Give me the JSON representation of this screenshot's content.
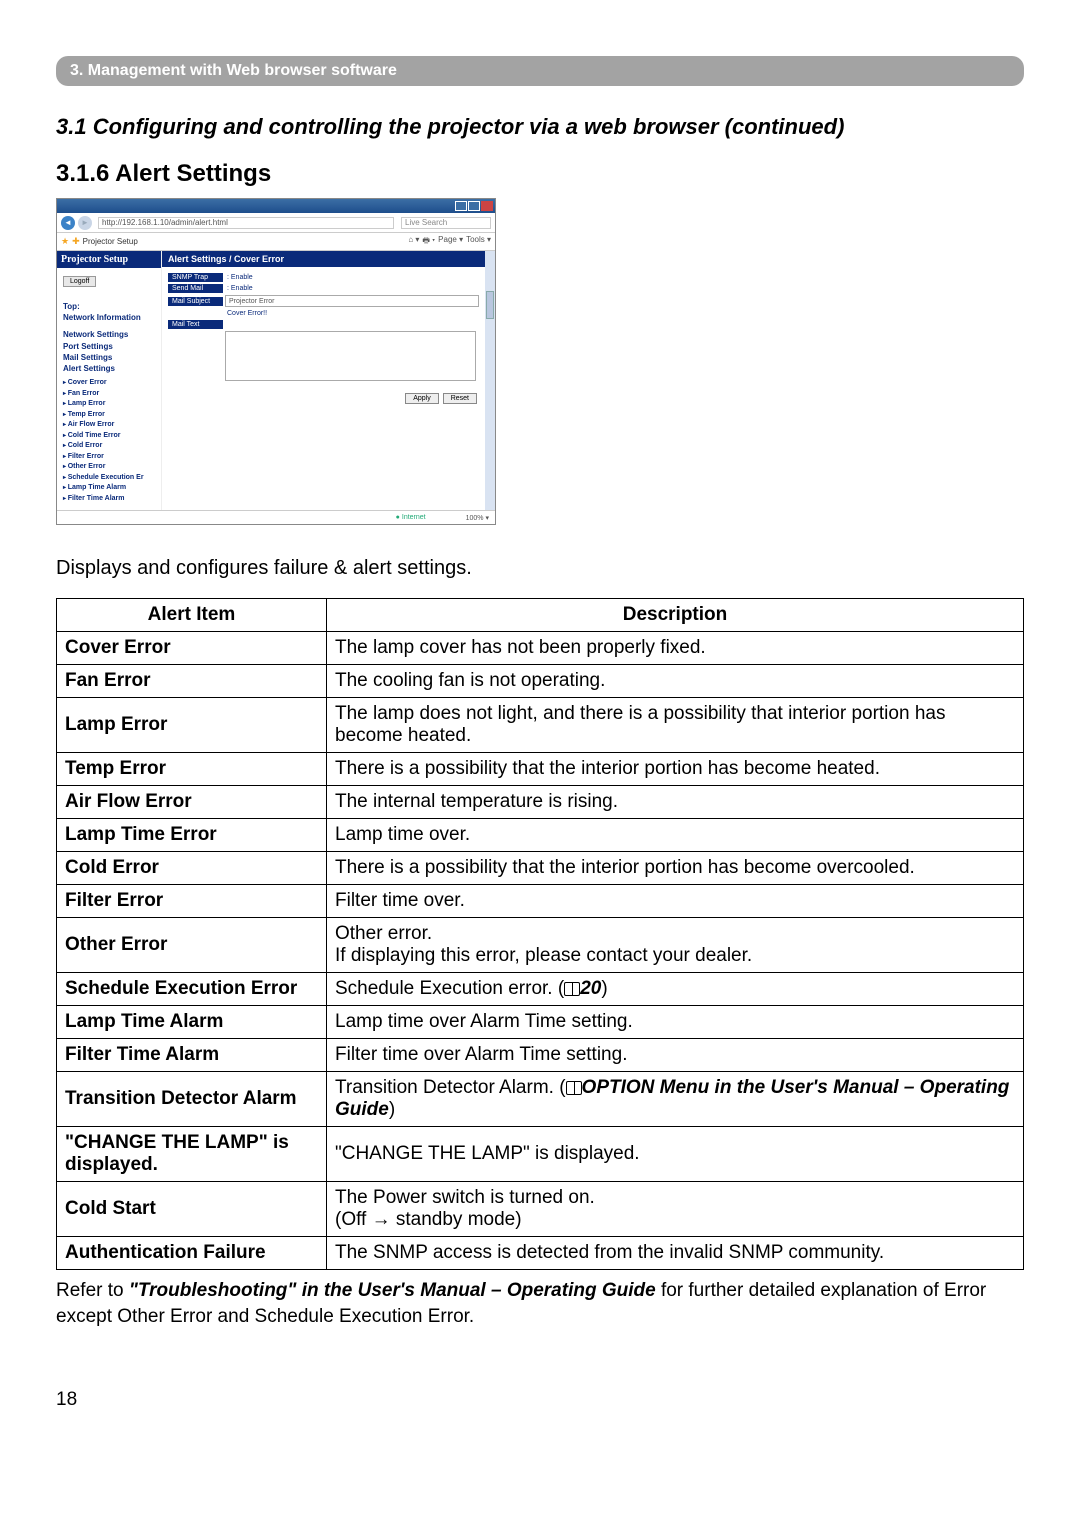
{
  "breadcrumb": "3. Management with Web browser software",
  "subhead": "3.1 Configuring and controlling the projector via a web browser (continued)",
  "heading": "3.1.6 Alert Settings",
  "intro": "Displays and configures failure & alert settings.",
  "page_number": "18",
  "screenshot": {
    "address": "http://192.168.1.10/admin/alert.html",
    "search_placeholder": "Live Search",
    "tab_label": "Projector Setup",
    "tools": [
      "Home",
      "Print",
      "Page",
      "Tools"
    ],
    "side_heading": "Projector Setup",
    "logoff": "Logoff",
    "nav_top": "Top:",
    "nav_network": "Network Information",
    "nav_items": [
      "Network Settings",
      "Port Settings",
      "Mail Settings",
      "Alert Settings"
    ],
    "nav_sub": [
      "Cover Error",
      "Fan Error",
      "Lamp Error",
      "Temp Error",
      "Air Flow Error",
      "Cold Time Error",
      "Cold Error",
      "Filter Error",
      "Other Error",
      "Schedule Execution Er",
      "Lamp Time Alarm",
      "Filter Time Alarm"
    ],
    "panel_title": "Alert Settings / Cover Error",
    "rows": {
      "snmp_trap_label": "SNMP Trap",
      "snmp_trap_val": ": Enable",
      "send_mail_label": "Send Mail",
      "send_mail_val": ": Enable",
      "subject_label": "Mail Subject",
      "subject_val": "Projector Error",
      "objname_val": "Cover Error!!",
      "mailtext_label": "Mail Text"
    },
    "apply": "Apply",
    "reset": "Reset",
    "status_ie": "Internet",
    "status_zoom": "100%"
  },
  "table": {
    "head_item": "Alert Item",
    "head_desc": "Description",
    "rows": [
      {
        "item": "Cover Error",
        "desc": "The lamp cover has not been properly fixed."
      },
      {
        "item": "Fan Error",
        "desc": "The cooling fan is not operating."
      },
      {
        "item": "Lamp Error",
        "desc": "The lamp does not light, and there is a possibility that interior portion has become heated."
      },
      {
        "item": "Temp Error",
        "desc": "There is a possibility that the interior portion has become heated."
      },
      {
        "item": "Air Flow Error",
        "desc": "The internal temperature is rising."
      },
      {
        "item": "Lamp Time Error",
        "desc": "Lamp time over."
      },
      {
        "item": "Cold Error",
        "desc": "There is a possibility that the interior portion has become overcooled."
      },
      {
        "item": "Filter Error",
        "desc": "Filter time over."
      },
      {
        "item": "Other Error",
        "desc": "Other error.\nIf displaying this error, please contact your dealer."
      },
      {
        "item": "Schedule Execution Error",
        "desc_pre": "Schedule Execution error. (",
        "page_ref": "20",
        "desc_post": ")"
      },
      {
        "item": "Lamp Time Alarm",
        "desc": "Lamp time over Alarm Time setting."
      },
      {
        "item": "Filter Time Alarm",
        "desc": "Filter time over Alarm Time setting."
      },
      {
        "item": "Transition Detector Alarm",
        "desc_pre": "Transition Detector Alarm. (",
        "ref_strong": "OPTION Menu in the User's Manual – Operating Guide",
        "desc_post": ")"
      },
      {
        "item": "\"CHANGE THE LAMP\" is displayed.",
        "desc": "\"CHANGE THE LAMP\" is displayed."
      },
      {
        "item": "Cold Start",
        "desc": "The Power switch is turned on.\n(Off → standby mode)"
      },
      {
        "item": "Authentication Failure",
        "desc": "The SNMP access is detected from the invalid SNMP community."
      }
    ]
  },
  "footnote_pre": "Refer to ",
  "footnote_strong": "\"Troubleshooting\" in the User's Manual – Operating Guide",
  "footnote_post": " for further detailed explanation of Error except Other Error and Schedule Execution Error."
}
